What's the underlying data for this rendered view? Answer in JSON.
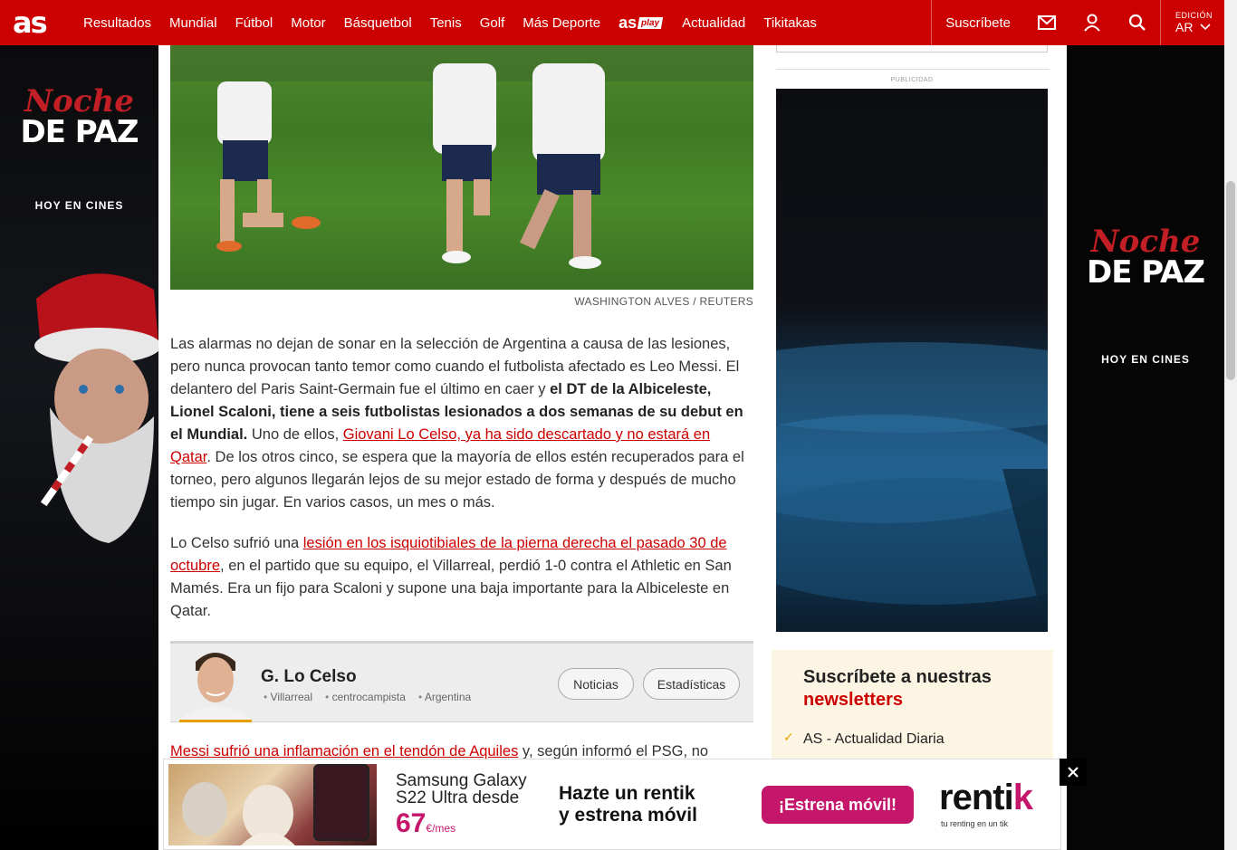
{
  "header": {
    "logo": "as",
    "nav": [
      "Resultados",
      "Mundial",
      "Fútbol",
      "Motor",
      "Básquetbol",
      "Tenis",
      "Golf",
      "Más Deporte"
    ],
    "asplay_logo": "as",
    "asplay_tag": "play",
    "nav2": [
      "Actualidad",
      "Tikitakas"
    ],
    "subscribe": "Suscríbete",
    "edition_label": "EDICIÓN",
    "edition_value": "AR"
  },
  "side_ad": {
    "title_top": "Noche",
    "title_bottom": "DE PAZ",
    "tagline": "HOY EN CINES"
  },
  "article": {
    "photo_credit": "WASHINGTON ALVES / REUTERS",
    "p1_a": "Las alarmas no dejan de sonar en la selección de Argentina a causa de las lesiones, pero nunca provocan tanto temor como cuando el futbolista afectado es Leo Messi. El delantero del Paris Saint-Germain fue el último en caer y ",
    "p1_bold": "el DT de la Albiceleste, Lionel Scaloni, tiene a seis futbolistas lesionados a dos semanas de su debut en el Mundial.",
    "p1_b": " Uno de ellos, ",
    "p1_link": "Giovani Lo Celso, ya ha sido descartado y no estará en Qatar",
    "p1_c": ". De los otros cinco, se espera que la mayoría de ellos estén recuperados para el torneo, pero algunos llegarán lejos de su mejor estado de forma y después de mucho tiempo sin jugar. En varios casos, un mes o más.",
    "p2_a": "Lo Celso sufrió una ",
    "p2_link": "lesión en los isquiotibiales de la pierna derecha el pasado 30 de octubre",
    "p2_b": ", en el partido que su equipo, el Villarreal, perdió 1-0 contra el Athletic en San Mamés. Era un fijo para Scaloni y supone una baja importante para la Albiceleste en Qatar.",
    "p3_link": "Messi sufrió una inflamación en el tendón de Aquiles",
    "p3_a": " y, según informó el PSG, no"
  },
  "player_card": {
    "name": "G. Lo Celso",
    "meta": [
      "Villarreal",
      "centrocampista",
      "Argentina"
    ],
    "btn_news": "Noticias",
    "btn_stats": "Estadísticas"
  },
  "sidebar": {
    "pub_label": "PUBLICIDAD",
    "newsletter_line1": "Suscríbete a nuestras",
    "newsletter_line2": "newsletters",
    "newsletter_item": "AS - Actualidad Diaria"
  },
  "sticky_ad": {
    "s22_line1": "Samsung Galaxy",
    "s22_line2": "S22 Ultra desde",
    "price": "67",
    "price_unit": "€",
    "price_per": "/mes",
    "tag_line1": "Hazte un rentik",
    "tag_line2": "y estrena móvil",
    "cta": "¡Estrena móvil!",
    "brand": "renti",
    "brand_k": "k",
    "brand_sub": "tu renting en un tik"
  }
}
